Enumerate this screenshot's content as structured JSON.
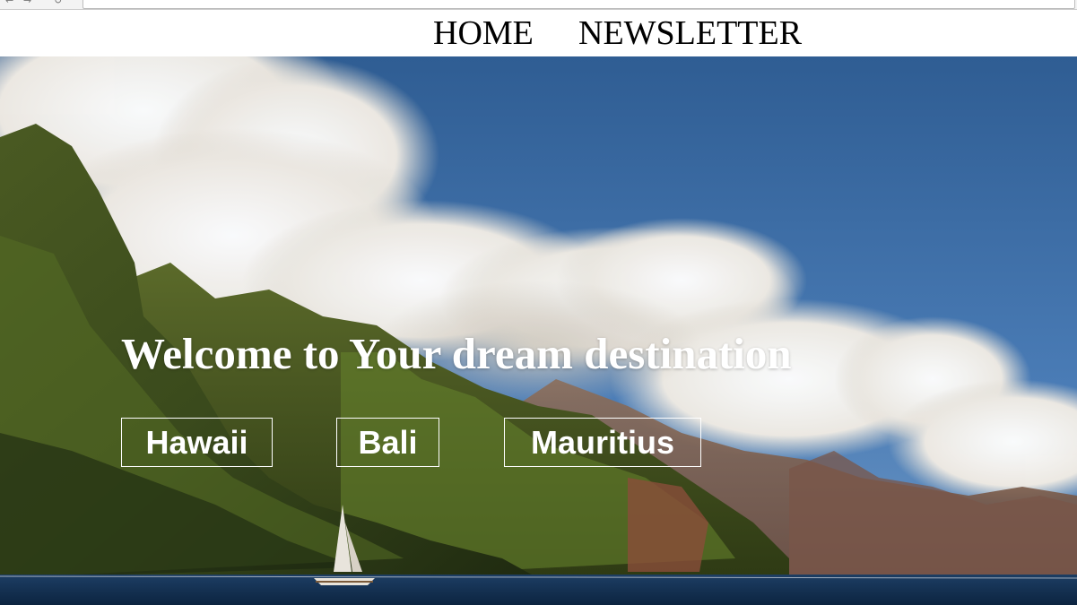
{
  "nav": {
    "home_label": "HOME",
    "newsletter_label": "NEWSLETTER"
  },
  "hero": {
    "title": "Welcome to Your dream destination",
    "background": "photo of green sea cliffs under a blue sky with white clouds and a sailboat on the ocean"
  },
  "destinations": [
    {
      "label": "Hawaii"
    },
    {
      "label": "Bali"
    },
    {
      "label": "Mauritius"
    }
  ],
  "colors": {
    "nav_background": "#ffffff",
    "nav_text": "#000000",
    "hero_text": "#ffffff",
    "button_border": "#ffffff"
  }
}
